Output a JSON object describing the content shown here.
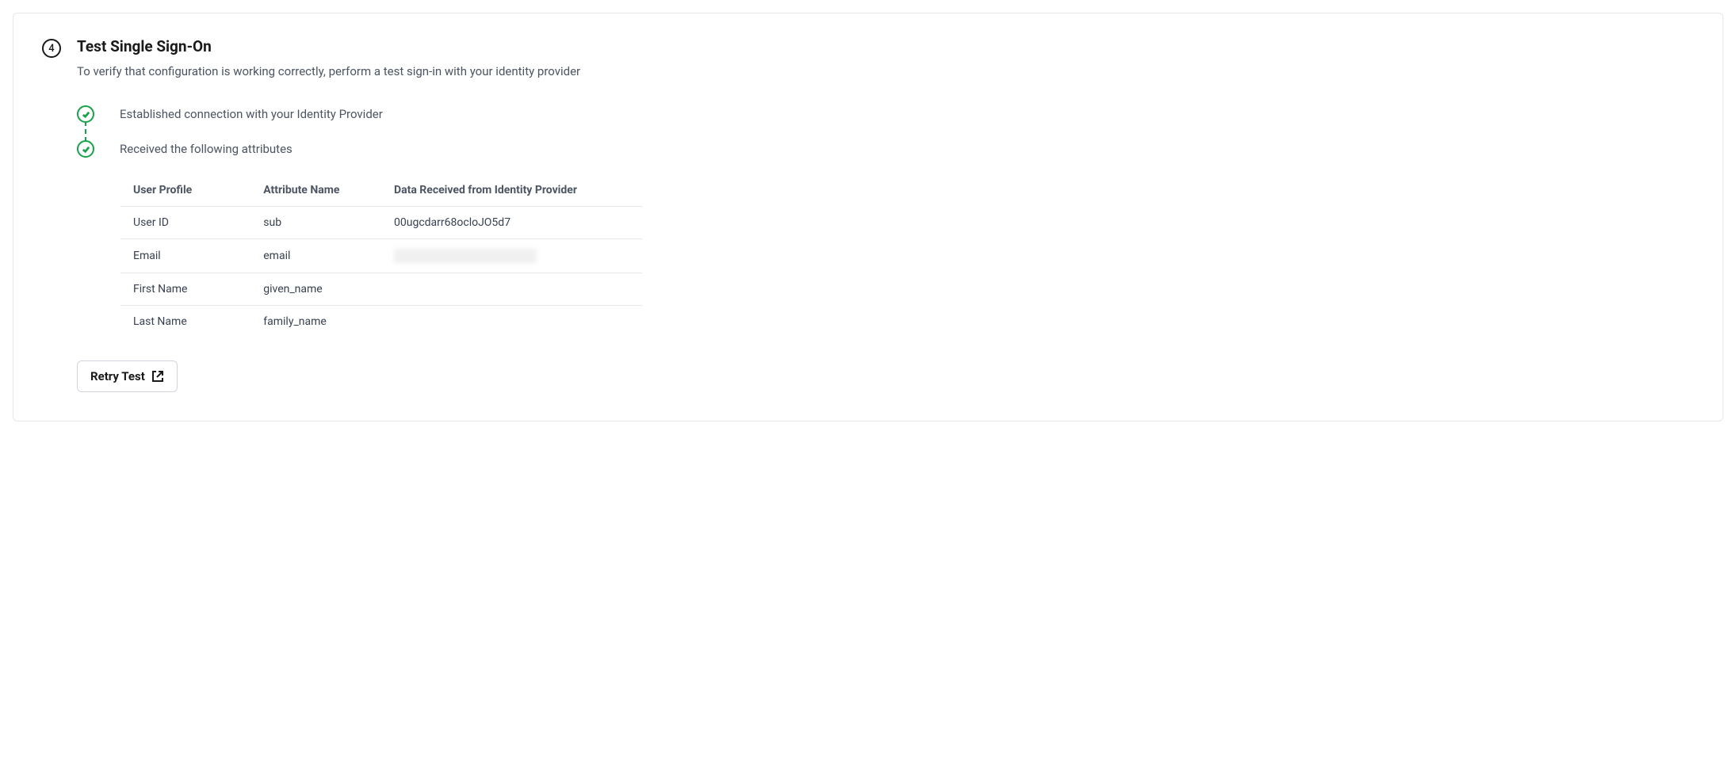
{
  "step": {
    "number": "4",
    "title": "Test Single Sign-On",
    "subtitle": "To verify that configuration is working correctly, perform a test sign-in with your identity provider"
  },
  "status": {
    "established": "Established connection with your Identity Provider",
    "received": "Received the following attributes"
  },
  "table": {
    "headers": {
      "profile": "User Profile",
      "attribute": "Attribute Name",
      "data": "Data Received from Identity Provider"
    },
    "rows": [
      {
        "profile": "User ID",
        "attribute": "sub",
        "data": "00ugcdarr68ocloJO5d7",
        "redacted": false
      },
      {
        "profile": "Email",
        "attribute": "email",
        "data": "",
        "redacted": true
      },
      {
        "profile": "First Name",
        "attribute": "given_name",
        "data": "",
        "redacted": false
      },
      {
        "profile": "Last Name",
        "attribute": "family_name",
        "data": "",
        "redacted": false
      }
    ]
  },
  "actions": {
    "retry": "Retry Test"
  }
}
